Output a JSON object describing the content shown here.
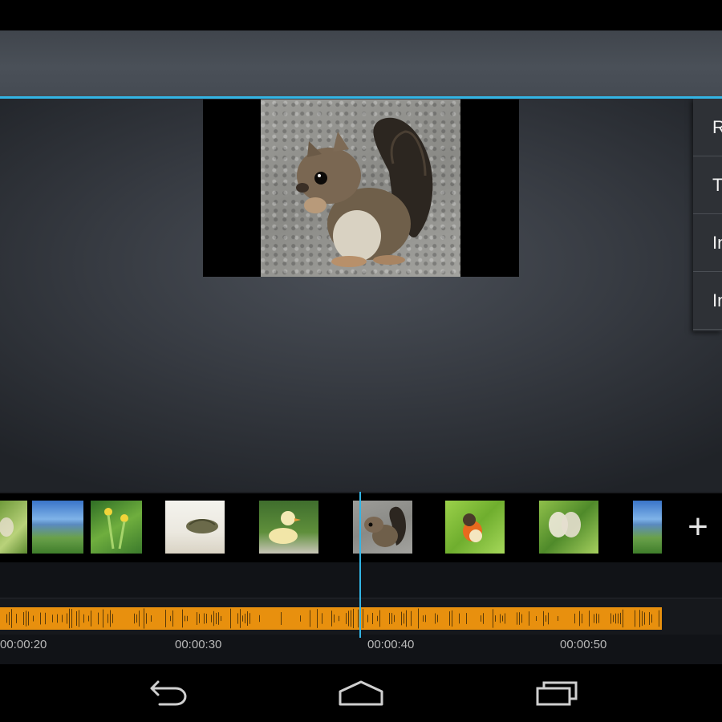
{
  "menu": {
    "items": [
      {
        "label": "Remove"
      },
      {
        "label": "Transition"
      },
      {
        "label": "Insert"
      },
      {
        "label": "Insert"
      }
    ]
  },
  "timeline": {
    "add_label": "+",
    "clips": [
      {
        "name": "butterfly"
      },
      {
        "name": "landscape"
      },
      {
        "name": "flower"
      },
      {
        "name": "bird-nest"
      },
      {
        "name": "duckling"
      },
      {
        "name": "squirrel"
      },
      {
        "name": "robin"
      },
      {
        "name": "butterfly"
      },
      {
        "name": "landscape"
      }
    ],
    "time_labels": [
      "00:00:20",
      "00:00:30",
      "00:00:40",
      "00:00:50"
    ]
  },
  "icons": {
    "back": "back-arrow-icon",
    "home": "home-icon",
    "recents": "recent-apps-icon",
    "add": "plus-icon"
  },
  "colors": {
    "accent": "#33b5e5",
    "audio": "#e8900e"
  }
}
